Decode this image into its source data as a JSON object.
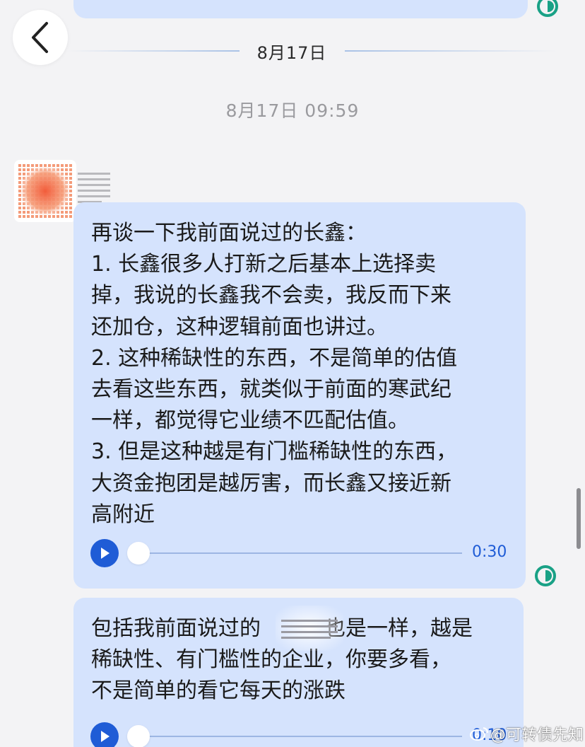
{
  "header": {
    "back_icon": "chevron-left-icon"
  },
  "date_divider": "8月17日",
  "timestamp": "8月17日 09:59",
  "messages": [
    {
      "lines": [
        "再谈一下我前面说过的长鑫：",
        "1. 长鑫很多人打新之后基本上选择卖",
        "掉，我说的长鑫我不会卖，我反而下来",
        "还加仓，这种逻辑前面也讲过。",
        "2. 这种稀缺性的东西，不是简单的估值",
        "去看这些东西，就类似于前面的寒武纪",
        "一样，都觉得它业绩不匹配估值。",
        "3. 但是这种越是有门槛稀缺性的东西，",
        "大资金抱团是越厉害，而长鑫又接近新",
        "高附近"
      ],
      "voice_duration": "0:30",
      "voice_progress": 0
    },
    {
      "lines": [
        "包括我前面说过的　　　也是一样，越是",
        "稀缺性、有门槛性的企业，你要多看，",
        "不是简单的看它每天的涨跌"
      ],
      "voice_duration": "0:10",
      "voice_progress": 0
    }
  ],
  "watermark": "@可转债先知",
  "colors": {
    "bubble": "#d5e3fd",
    "accent_blue": "#1f5cd6",
    "read_green": "#19a186",
    "background": "#f3f3f5"
  }
}
